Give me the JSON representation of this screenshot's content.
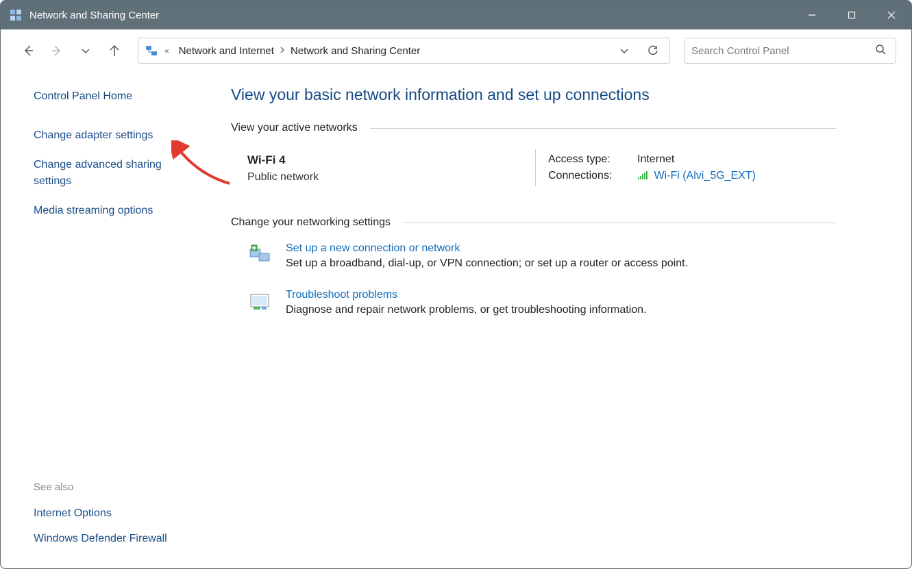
{
  "window": {
    "title": "Network and Sharing Center"
  },
  "breadcrumbs": {
    "seg1": "Network and Internet",
    "seg2": "Network and Sharing Center"
  },
  "search": {
    "placeholder": "Search Control Panel"
  },
  "sidebar": {
    "home": "Control Panel Home",
    "links": [
      "Change adapter settings",
      "Change advanced sharing settings",
      "Media streaming options"
    ],
    "see_also_label": "See also",
    "see_also": [
      "Internet Options",
      "Windows Defender Firewall"
    ]
  },
  "main": {
    "heading": "View your basic network information and set up connections",
    "active_title": "View your active networks",
    "network": {
      "name": "Wi-Fi 4",
      "kind": "Public network",
      "access_label": "Access type:",
      "access_value": "Internet",
      "conn_label": "Connections:",
      "conn_value": "Wi-Fi (Alvi_5G_EXT)"
    },
    "change_title": "Change your networking settings",
    "items": [
      {
        "title": "Set up a new connection or network",
        "desc": "Set up a broadband, dial-up, or VPN connection; or set up a router or access point."
      },
      {
        "title": "Troubleshoot problems",
        "desc": "Diagnose and repair network problems, or get troubleshooting information."
      }
    ]
  }
}
